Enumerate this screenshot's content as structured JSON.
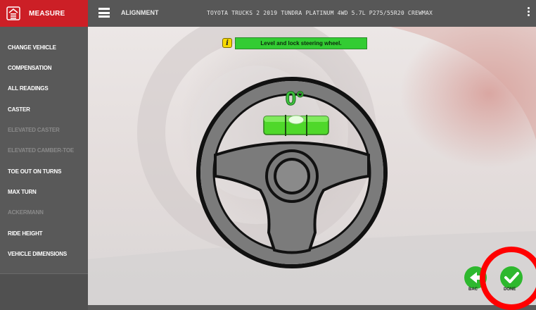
{
  "header": {
    "tab_label": "MEASURE",
    "section": "ALIGNMENT",
    "vehicle": "TOYOTA TRUCKS 2 2019 TUNDRA PLATINUM 4WD 5.7L P275/55R20 CREWMAX"
  },
  "sidebar": {
    "items": [
      {
        "label": "CHANGE VEHICLE",
        "enabled": true
      },
      {
        "label": "COMPENSATION",
        "enabled": true
      },
      {
        "label": "ALL READINGS",
        "enabled": true
      },
      {
        "label": "CASTER",
        "enabled": true
      },
      {
        "label": "ELEVATED CASTER",
        "enabled": false
      },
      {
        "label": "ELEVATED CAMBER-TOE",
        "enabled": false
      },
      {
        "label": "TOE OUT ON TURNS",
        "enabled": true
      },
      {
        "label": "MAX TURN",
        "enabled": true
      },
      {
        "label": "ACKERMANN",
        "enabled": false
      },
      {
        "label": "RIDE HEIGHT",
        "enabled": true
      },
      {
        "label": "VEHICLE DIMENSIONS",
        "enabled": true
      }
    ]
  },
  "main": {
    "instruction": "Level and lock steering wheel.",
    "info_icon": "i",
    "angle": "0°",
    "back_label": "BAC",
    "done_label": "DONE"
  },
  "colors": {
    "accent_red": "#cc1f26",
    "status_green": "#33cc33",
    "annotation_ring": "#ff0000"
  }
}
